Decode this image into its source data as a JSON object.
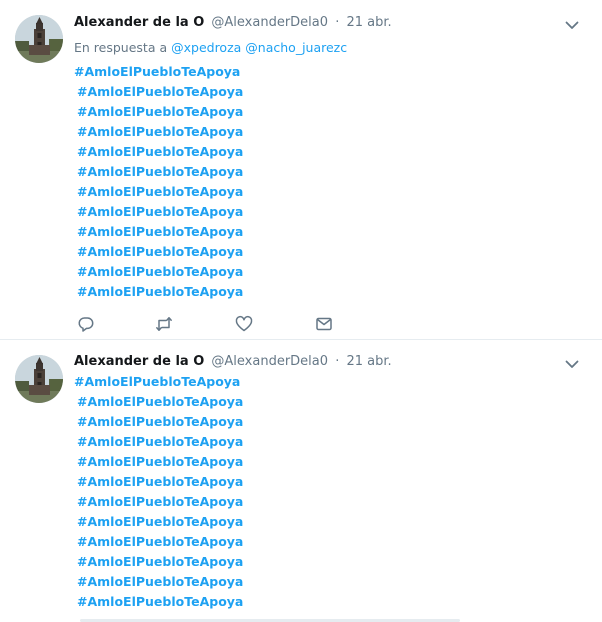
{
  "tweets": [
    {
      "author": {
        "name": "Alexander de la O",
        "handle": "@AlexanderDela0",
        "avatar": "church-tower-photo"
      },
      "separator": "·",
      "time": "21 abr.",
      "reply_to": {
        "prefix": "En respuesta a",
        "mentions": [
          "@xpedroza",
          "@nacho_juarezc"
        ]
      },
      "hashtags": [
        "#AmloElPuebloTeApoya",
        "#AmloElPuebloTeApoya",
        "#AmloElPuebloTeApoya",
        "#AmloElPuebloTeApoya",
        "#AmloElPuebloTeApoya",
        "#AmloElPuebloTeApoya",
        "#AmloElPuebloTeApoya",
        "#AmloElPuebloTeApoya",
        "#AmloElPuebloTeApoya",
        "#AmloElPuebloTeApoya",
        "#AmloElPuebloTeApoya",
        "#AmloElPuebloTeApoya"
      ],
      "actions": [
        "reply-icon",
        "retweet-icon",
        "like-icon",
        "direct-message-icon"
      ],
      "menu_icon": "chevron-down-icon"
    },
    {
      "author": {
        "name": "Alexander de la O",
        "handle": "@AlexanderDela0",
        "avatar": "church-tower-photo"
      },
      "separator": "·",
      "time": "21 abr.",
      "hashtags": [
        "#AmloElPuebloTeApoya",
        "#AmloElPuebloTeApoya",
        "#AmloElPuebloTeApoya",
        "#AmloElPuebloTeApoya",
        "#AmloElPuebloTeApoya",
        "#AmloElPuebloTeApoya",
        "#AmloElPuebloTeApoya",
        "#AmloElPuebloTeApoya",
        "#AmloElPuebloTeApoya",
        "#AmloElPuebloTeApoya",
        "#AmloElPuebloTeApoya",
        "#AmloElPuebloTeApoya"
      ],
      "menu_icon": "chevron-down-icon"
    }
  ],
  "colors": {
    "link": "#1da1f2",
    "text": "#14171a",
    "muted": "#657786",
    "divider": "#e6ecf0"
  }
}
